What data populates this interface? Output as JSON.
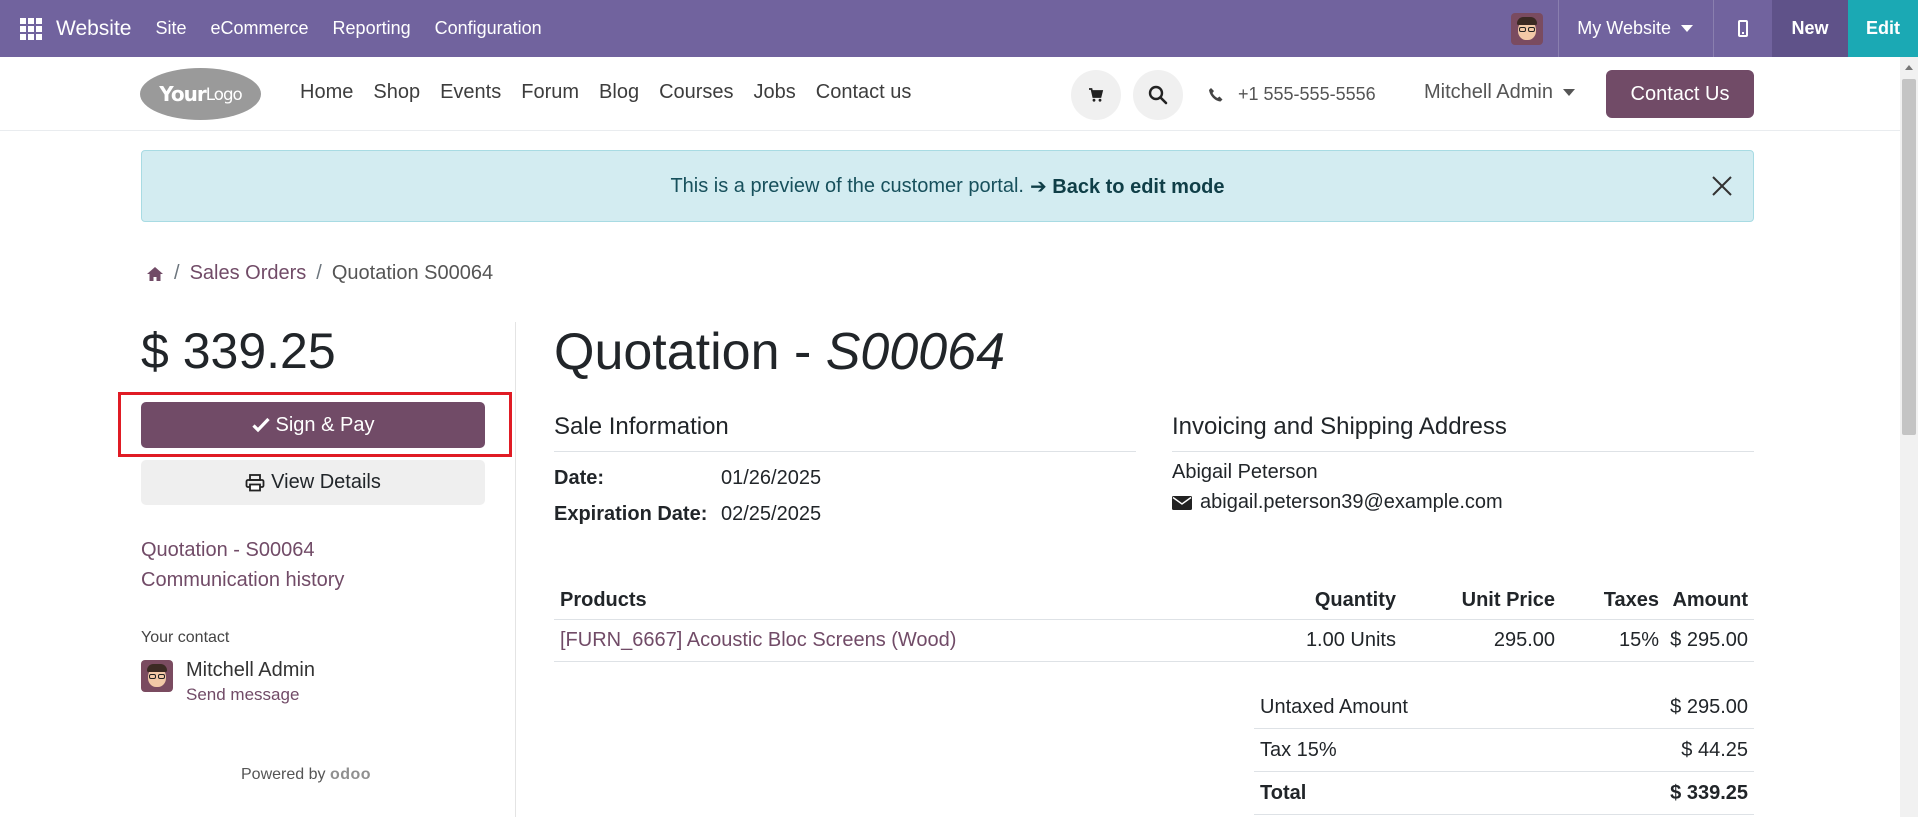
{
  "topbar": {
    "brand": "Website",
    "menus": [
      "Site",
      "eCommerce",
      "Reporting",
      "Configuration"
    ],
    "site_selector": "My Website",
    "new_label": "New",
    "edit_label": "Edit"
  },
  "header": {
    "logo_text_bold": "Your",
    "logo_text_light": "Logo",
    "nav": [
      "Home",
      "Shop",
      "Events",
      "Forum",
      "Blog",
      "Courses",
      "Jobs",
      "Contact us"
    ],
    "phone": "+1 555-555-5556",
    "user": "Mitchell Admin",
    "contact_button": "Contact Us"
  },
  "alert": {
    "message": "This is a preview of the customer portal.",
    "back_link": "➔ Back to edit mode"
  },
  "breadcrumb": {
    "items": [
      "Sales Orders",
      "Quotation S00064"
    ]
  },
  "sidebar": {
    "total": "$ 339.25",
    "sign_pay": "Sign & Pay",
    "view_details": "View Details",
    "links": [
      "Quotation - S00064",
      "Communication history"
    ],
    "contact_label": "Your contact",
    "contact_name": "Mitchell Admin",
    "send_message": "Send message",
    "powered_by": "Powered by",
    "powered_brand": "odoo"
  },
  "quotation": {
    "title_prefix": "Quotation -",
    "number": "S00064",
    "sale_info_title": "Sale Information",
    "date_label": "Date:",
    "date_value": "01/26/2025",
    "expiration_label": "Expiration Date:",
    "expiration_value": "02/25/2025",
    "address_title": "Invoicing and Shipping Address",
    "customer_name": "Abigail Peterson",
    "customer_email": "abigail.peterson39@example.com"
  },
  "products_table": {
    "headers": [
      "Products",
      "Quantity",
      "Unit Price",
      "Taxes",
      "Amount"
    ],
    "rows": [
      {
        "product": "[FURN_6667] Acoustic Bloc Screens (Wood)",
        "quantity": "1.00 Units",
        "unit_price": "295.00",
        "taxes": "15%",
        "amount": "$ 295.00"
      }
    ]
  },
  "totals": {
    "untaxed_label": "Untaxed Amount",
    "untaxed_value": "$ 295.00",
    "tax_label": "Tax 15%",
    "tax_value": "$ 44.25",
    "total_label": "Total",
    "total_value": "$ 339.25"
  },
  "colors": {
    "topbar": "#71639e",
    "primary": "#714b67",
    "edit": "#1ba9b4",
    "alert_bg": "#d3ecf1",
    "highlight": "#e01b24"
  }
}
